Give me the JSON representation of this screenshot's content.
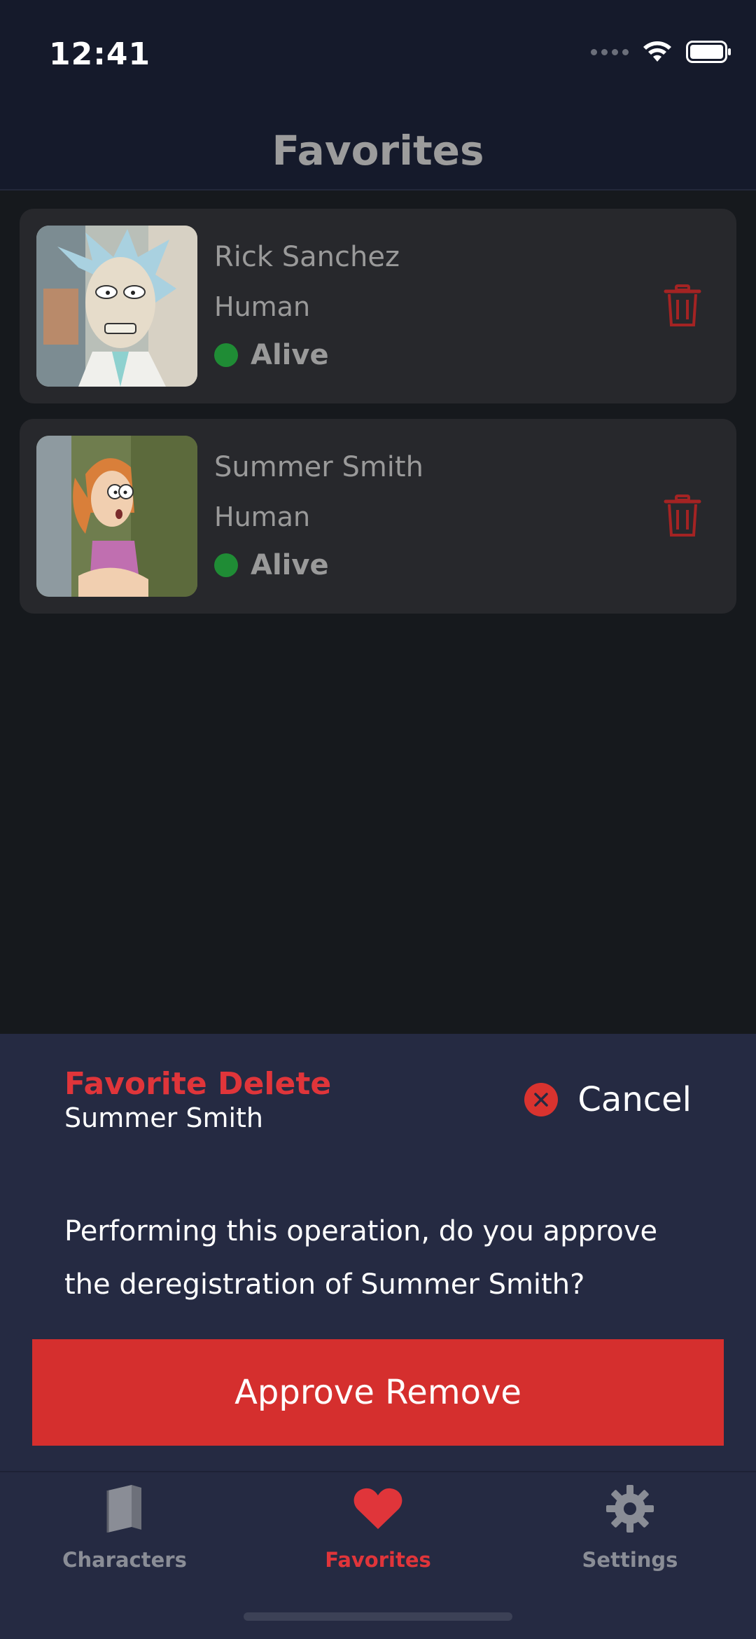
{
  "status_bar": {
    "time": "12:41"
  },
  "header": {
    "title": "Favorites"
  },
  "favorites": [
    {
      "name": "Rick Sanchez",
      "species": "Human",
      "status": "Alive",
      "status_color": "#1f8c35",
      "avatar": "rick-avatar"
    },
    {
      "name": "Summer Smith",
      "species": "Human",
      "status": "Alive",
      "status_color": "#1f8c35",
      "avatar": "summer-avatar"
    }
  ],
  "delete_sheet": {
    "title": "Favorite Delete",
    "subtitle": "Summer Smith",
    "cancel_label": "Cancel",
    "message": "Performing this operation, do you approve the deregistration of Summer Smith?",
    "approve_label": "Approve Remove"
  },
  "tab_bar": {
    "tabs": [
      {
        "label": "Characters",
        "icon": "book-icon",
        "active": false
      },
      {
        "label": "Favorites",
        "icon": "heart-icon",
        "active": true
      },
      {
        "label": "Settings",
        "icon": "gear-icon",
        "active": false
      }
    ]
  },
  "colors": {
    "accent": "#e0353a",
    "background": "#16191d",
    "card": "#27282c",
    "sheet": "#252a42",
    "header": "#151a2b"
  }
}
